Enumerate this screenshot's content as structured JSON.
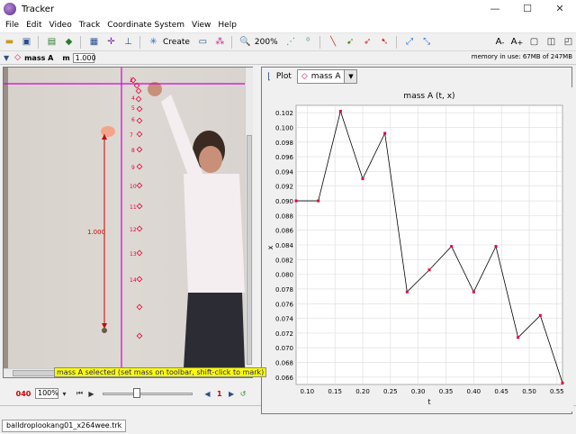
{
  "window": {
    "title": "Tracker",
    "controls": [
      "—",
      "☐",
      "✕"
    ]
  },
  "menu": [
    "File",
    "Edit",
    "Video",
    "Track",
    "Coordinate System",
    "View",
    "Help"
  ],
  "toolbar": {
    "create_label": "Create",
    "zoom_label": "200%"
  },
  "trackbar": {
    "track_name": "mass A",
    "mass_label": "m",
    "mass_value": "1.000",
    "memory": "memory in use: 67MB of 247MB"
  },
  "video": {
    "calibration_label": "1.000",
    "status_message": "mass A selected (set mass on toolbar, shift-click to mark)",
    "point_labels": [
      "2",
      "4",
      "5",
      "6",
      "7",
      "8",
      "9",
      "10",
      "11",
      "12",
      "13",
      "14"
    ]
  },
  "player": {
    "frame": "040",
    "zoom": "100%",
    "step": "1"
  },
  "file_tab": "balldroplookang01_x264wee.trk",
  "plot": {
    "label": "Plot",
    "track": "mass A"
  },
  "chart_data": {
    "type": "line",
    "title": "mass A (t, x)",
    "xlabel": "t",
    "ylabel": "x",
    "x": [
      0.08,
      0.12,
      0.16,
      0.2,
      0.24,
      0.28,
      0.32,
      0.36,
      0.4,
      0.44,
      0.48,
      0.52,
      0.56
    ],
    "y": [
      0.09,
      0.09,
      0.1022,
      0.093,
      0.0992,
      0.0776,
      0.0806,
      0.0838,
      0.0776,
      0.0838,
      0.0714,
      0.0744,
      0.0652
    ],
    "xlim": [
      0.08,
      0.56
    ],
    "ylim": [
      0.065,
      0.103
    ],
    "xticks": [
      0.1,
      0.15,
      0.2,
      0.25,
      0.3,
      0.35,
      0.4,
      0.45,
      0.5,
      0.55
    ],
    "yticks": [
      0.066,
      0.068,
      0.07,
      0.072,
      0.074,
      0.076,
      0.078,
      0.08,
      0.082,
      0.084,
      0.086,
      0.088,
      0.09,
      0.092,
      0.094,
      0.096,
      0.098,
      0.1,
      0.102
    ],
    "grid": true,
    "line_color": "#000000",
    "marker_color": "#e8003c"
  }
}
